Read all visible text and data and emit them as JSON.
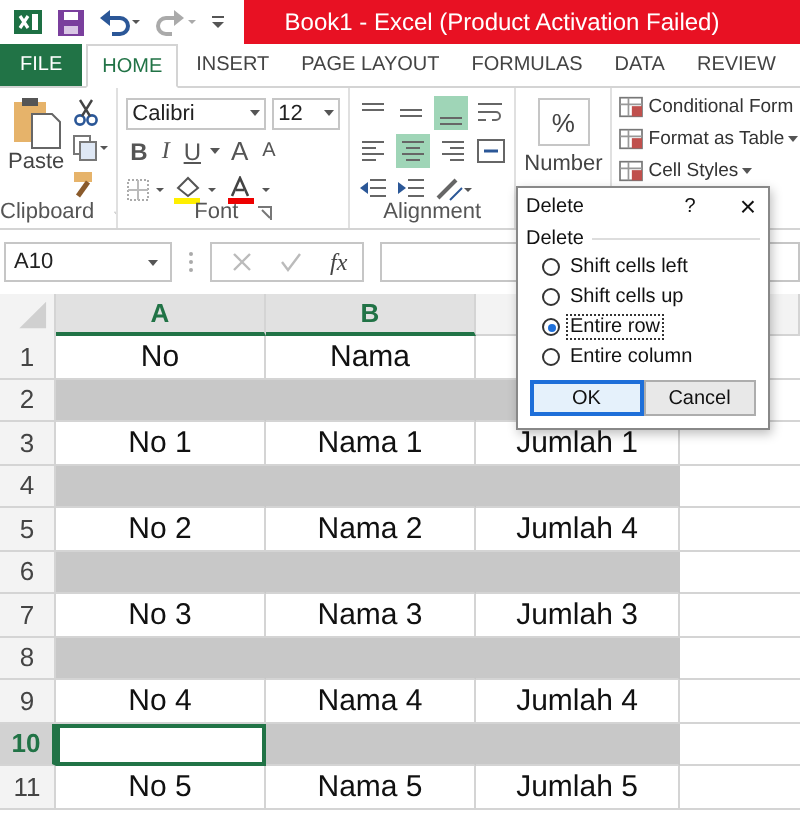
{
  "window": {
    "title": "Book1 -  Excel (Product Activation Failed)"
  },
  "tabs": [
    {
      "label": "FILE",
      "kind": "file",
      "selected": false
    },
    {
      "label": "HOME",
      "kind": "tab",
      "selected": true
    },
    {
      "label": "INSERT",
      "kind": "tab",
      "selected": false
    },
    {
      "label": "PAGE LAYOUT",
      "kind": "tab",
      "selected": false
    },
    {
      "label": "FORMULAS",
      "kind": "tab",
      "selected": false
    },
    {
      "label": "DATA",
      "kind": "tab",
      "selected": false
    },
    {
      "label": "REVIEW",
      "kind": "tab",
      "selected": false
    }
  ],
  "ribbon": {
    "clipboard": {
      "paste": "Paste",
      "label": "Clipboard"
    },
    "font": {
      "name": "Calibri",
      "size": "12",
      "bold": "B",
      "italic": "I",
      "underline": "U",
      "grow": "A",
      "shrink": "A",
      "label": "Font"
    },
    "alignment": {
      "label": "Alignment"
    },
    "number": {
      "symbol": "%",
      "label": "Number"
    },
    "styles": [
      "Conditional Form",
      "Format as Table",
      "Cell Styles"
    ]
  },
  "formula_bar": {
    "name_box": "A10",
    "fx": "fx"
  },
  "columns": [
    {
      "label": "A",
      "selected": true
    },
    {
      "label": "B",
      "selected": true
    }
  ],
  "rows": [
    {
      "number": "1",
      "shaded": false,
      "selected": false,
      "cells": [
        "No",
        "Nama"
      ]
    },
    {
      "number": "2",
      "shaded": true,
      "selected": false
    },
    {
      "number": "3",
      "shaded": false,
      "selected": false,
      "cells": [
        "No 1",
        "Nama 1",
        "Jumlah 1"
      ]
    },
    {
      "number": "4",
      "shaded": true,
      "selected": false
    },
    {
      "number": "5",
      "shaded": false,
      "selected": false,
      "cells": [
        "No 2",
        "Nama 2",
        "Jumlah 4"
      ]
    },
    {
      "number": "6",
      "shaded": true,
      "selected": false
    },
    {
      "number": "7",
      "shaded": false,
      "selected": false,
      "cells": [
        "No 3",
        "Nama 3",
        "Jumlah 3"
      ]
    },
    {
      "number": "8",
      "shaded": true,
      "selected": false
    },
    {
      "number": "9",
      "shaded": false,
      "selected": false,
      "cells": [
        "No 4",
        "Nama 4",
        "Jumlah 4"
      ]
    },
    {
      "number": "10",
      "shaded": true,
      "selected": true
    },
    {
      "number": "11",
      "shaded": false,
      "selected": false,
      "cells": [
        "No 5",
        "Nama 5",
        "Jumlah 5"
      ]
    }
  ],
  "dialog": {
    "title": "Delete",
    "help": "?",
    "close": "×",
    "group": "Delete",
    "options": [
      {
        "label": "Shift cells left",
        "selected": false
      },
      {
        "label": "Shift cells up",
        "selected": false
      },
      {
        "label": "Entire row",
        "selected": true
      },
      {
        "label": "Entire column",
        "selected": false
      }
    ],
    "buttons": [
      {
        "label": "OK",
        "kind": "default"
      },
      {
        "label": "Cancel",
        "kind": "normal"
      }
    ]
  }
}
